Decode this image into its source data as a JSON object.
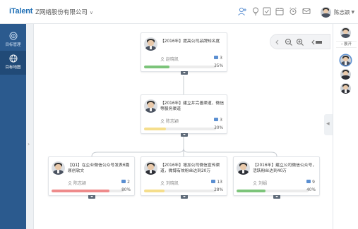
{
  "header": {
    "logo": "iTalent",
    "company": "Z网络股份有限公司",
    "user_name": "陈志颖"
  },
  "sidebar": {
    "items": [
      {
        "label": "目标管理",
        "icon": "target-icon",
        "active": false
      },
      {
        "label": "目标地图",
        "icon": "globe-icon",
        "active": true
      }
    ]
  },
  "right_panel": {
    "expand_label": "展开"
  },
  "cards": {
    "root": {
      "title": "【2016年】提高公司品牌知名度",
      "owner": "赵晓凯",
      "count": "3",
      "progress_label": "35%",
      "progress": 0.35,
      "color": "#7cc47a"
    },
    "mid": {
      "title": "【2016年】建立并完善渠道、微信等服务渠道",
      "owner": "陈志颖",
      "count": "3",
      "progress_label": "30%",
      "progress": 0.3,
      "color": "#f5de8c"
    },
    "left": {
      "title": "【Q1】在企业微信公众号发表6篇原创软文",
      "owner": "陈志颖",
      "count": "2",
      "progress_label": "80%",
      "progress": 0.8,
      "color": "#ee8b8b"
    },
    "center": {
      "title": "【2016年】增加公司微信宣传渠道，微博有效粉丝达到20万",
      "owner": "刘晓凯",
      "count": "13",
      "progress_label": "28%",
      "progress": 0.28,
      "color": "#f5de8c"
    },
    "right": {
      "title": "【2016年】建立公司微信公众号，活跃粉丝达到40万",
      "owner": "刘娟",
      "count": "9",
      "progress_label": "40%",
      "progress": 0.4,
      "color": "#7cc47a"
    }
  }
}
